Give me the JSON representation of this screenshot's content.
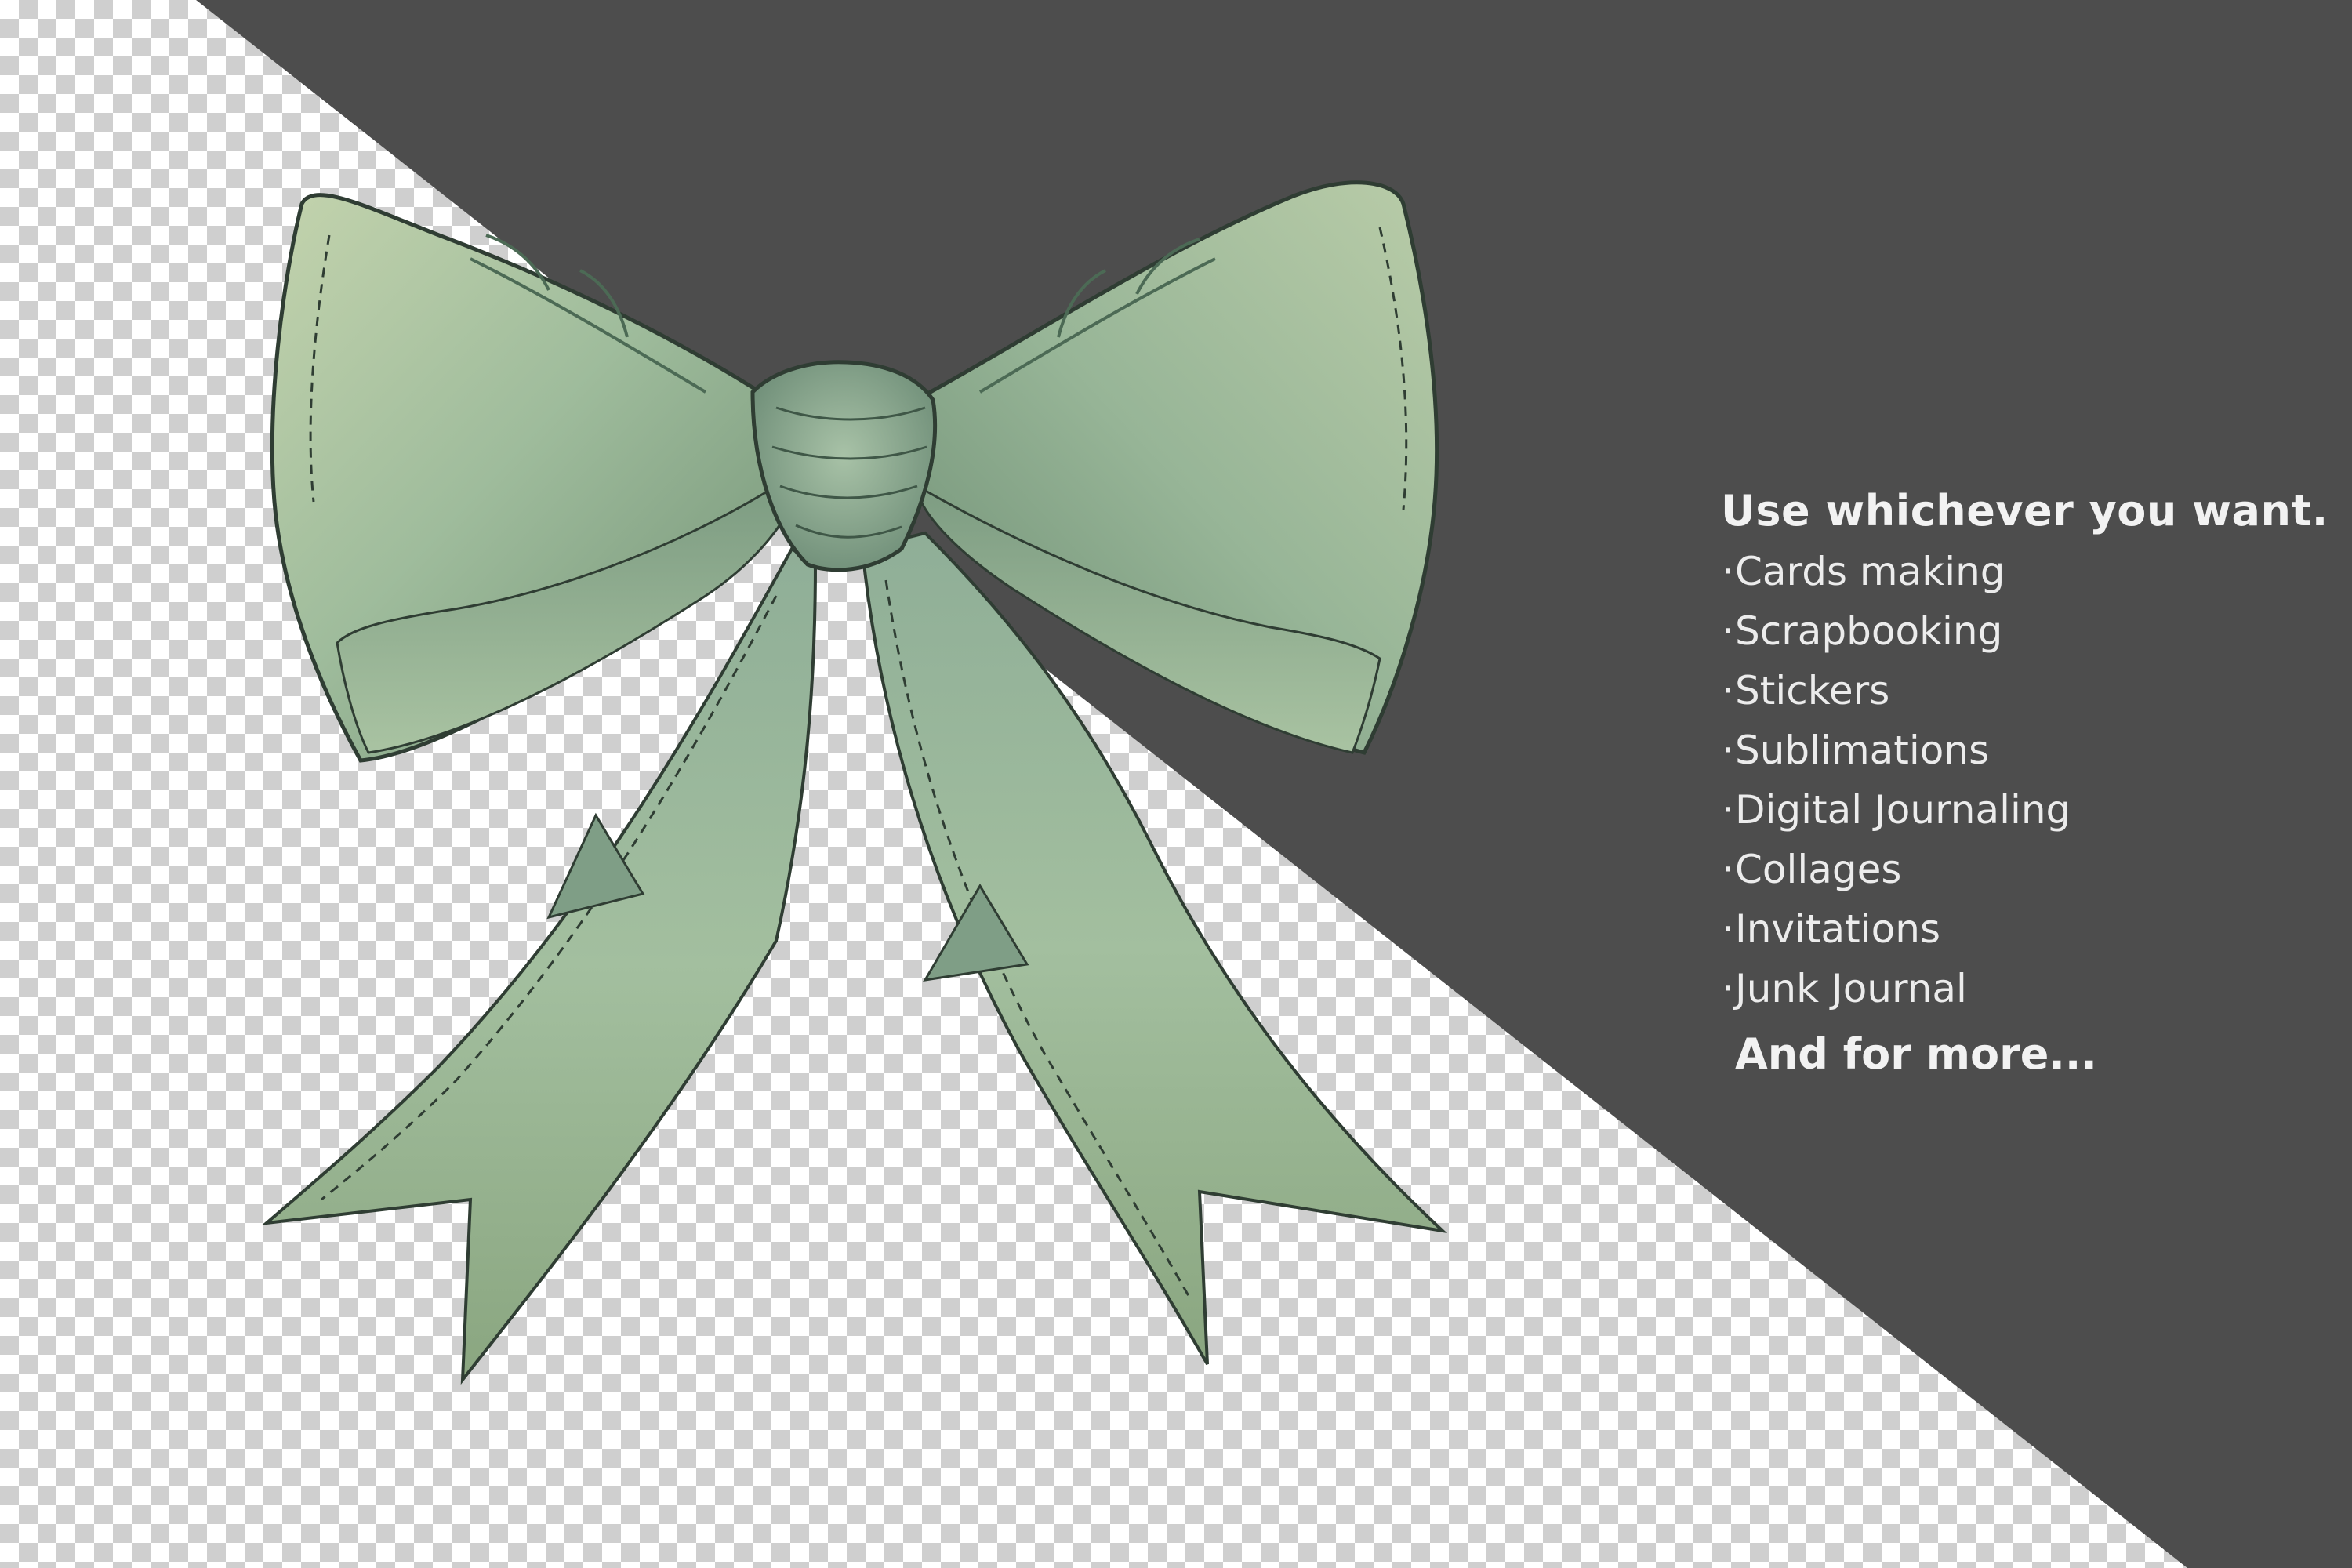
{
  "colors": {
    "panel": "#4d4d4d",
    "ribbon_light": "#b7ccad",
    "ribbon_mid": "#8fae90",
    "ribbon_dark": "#5f7d66",
    "ink": "#2f3d33",
    "text": "#f2f2f2"
  },
  "artwork": {
    "subject_icon": "ribbon-bow-icon"
  },
  "info": {
    "heading": "Use whichever you want.",
    "bullet": "·",
    "uses": [
      "Cards making",
      "Scrapbooking",
      "Stickers",
      "Sublimations",
      "Digital Journaling",
      "Collages",
      "Invitations",
      "Junk Journal"
    ],
    "footer": "And for more..."
  }
}
